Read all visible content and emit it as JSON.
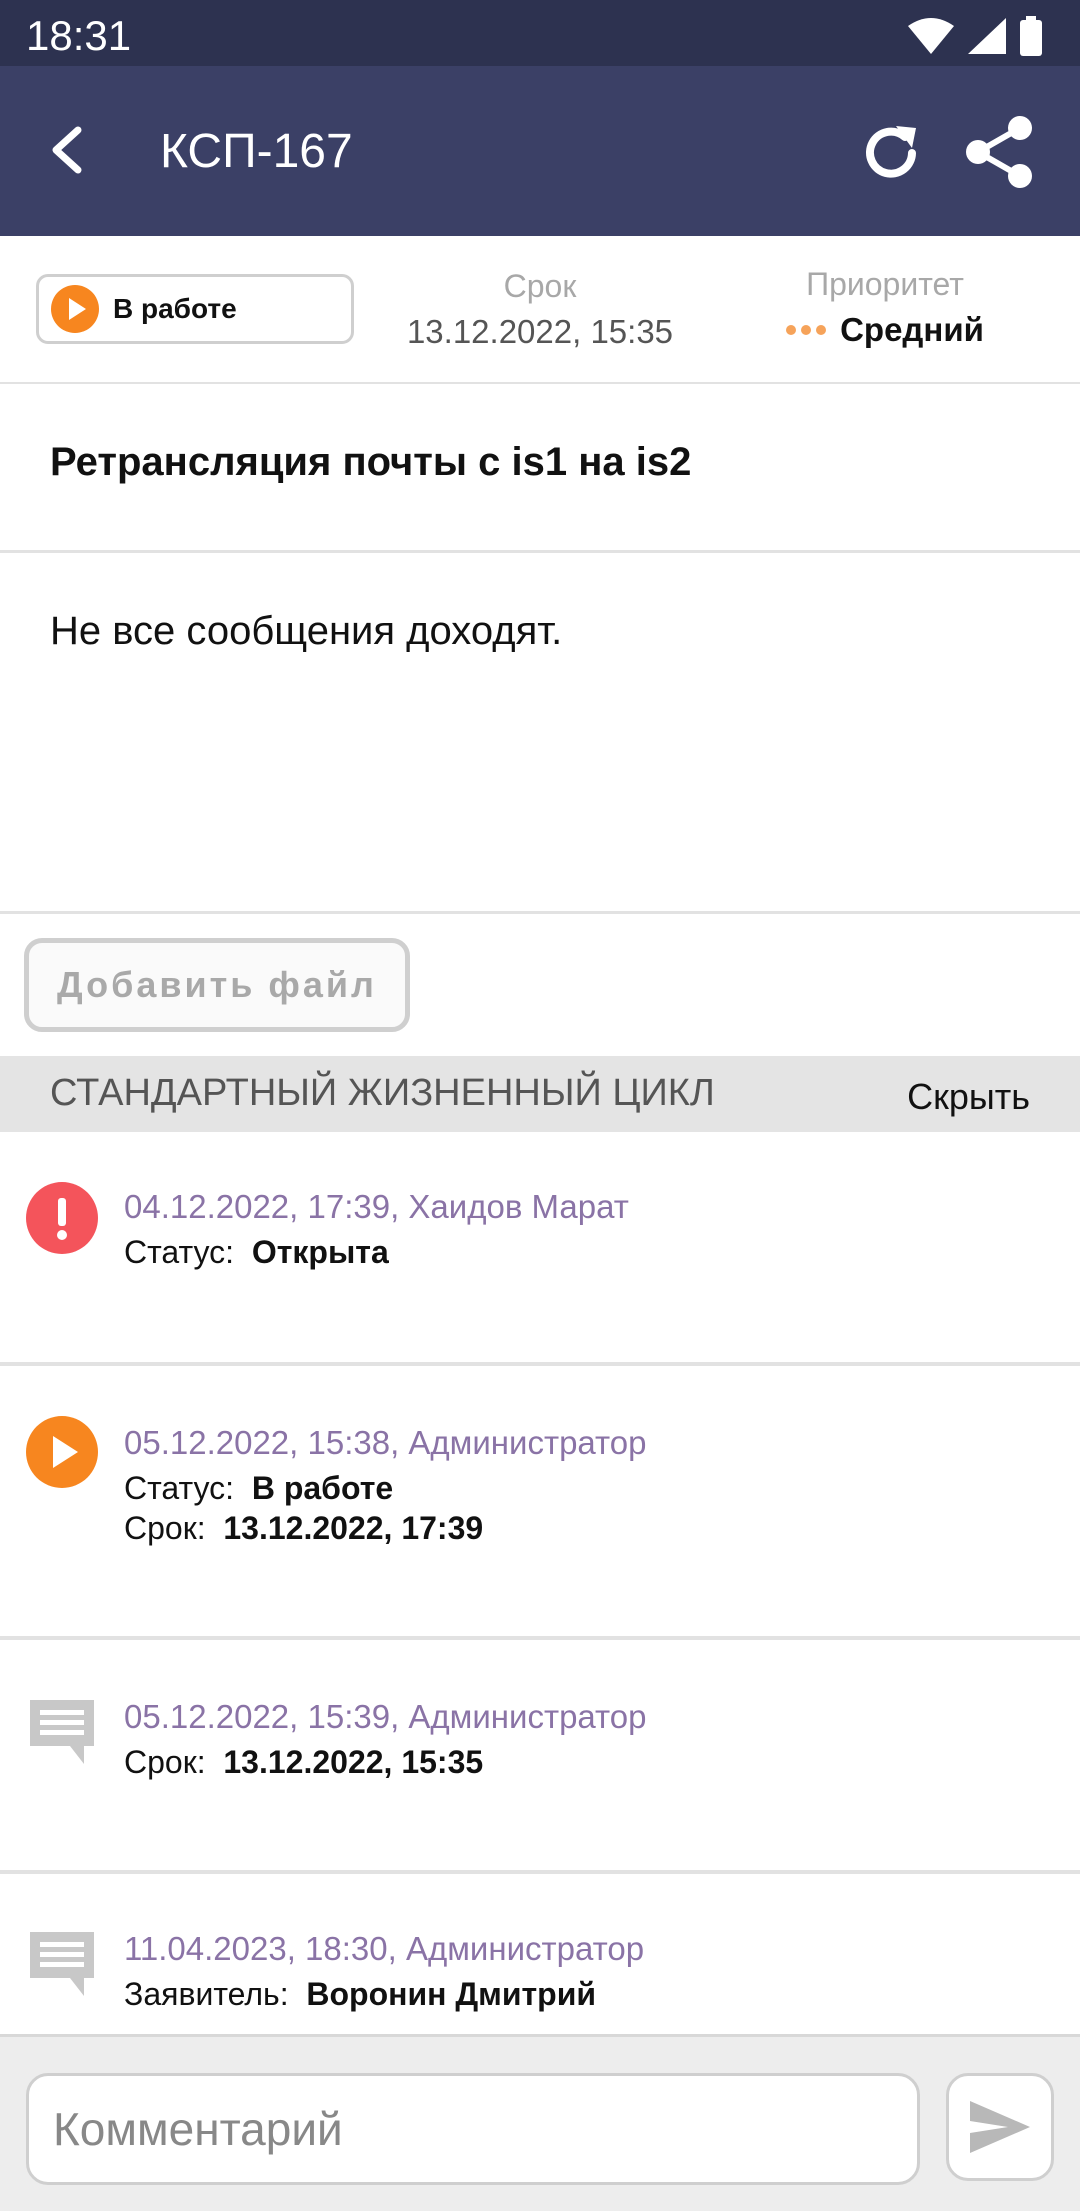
{
  "status_bar": {
    "time": "18:31"
  },
  "app_bar": {
    "title": "КСП-167",
    "icons": [
      "back-arrow-icon",
      "refresh-icon",
      "share-icon"
    ]
  },
  "info": {
    "status_label": "В работе",
    "deadline_caption": "Срок",
    "deadline_value": "13.12.2022, 15:35",
    "priority_caption": "Приоритет",
    "priority_value": "Средний"
  },
  "ticket": {
    "subject": "Ретрансляция почты с is1 на is2",
    "description": "Не все сообщения доходят."
  },
  "attach_button": "Добавить файл",
  "lifecycle": {
    "title": "СТАНДАРТНЫЙ ЖИЗНЕННЫЙ ЦИКЛ",
    "hide_label": "Скрыть",
    "entries": [
      {
        "icon": "alert-icon",
        "meta": "04.12.2022, 17:39, Хаидов Марат",
        "lines": [
          {
            "label": "Статус:",
            "value": "Открыта"
          }
        ]
      },
      {
        "icon": "play-icon",
        "meta": "05.12.2022, 15:38, Администратор",
        "lines": [
          {
            "label": "Статус:",
            "value": "В работе"
          },
          {
            "label": "Срок:",
            "value": "13.12.2022, 17:39"
          }
        ]
      },
      {
        "icon": "comment-icon",
        "meta": "05.12.2022, 15:39, Администратор",
        "lines": [
          {
            "label": "Срок:",
            "value": "13.12.2022, 15:35"
          }
        ]
      },
      {
        "icon": "comment-icon",
        "meta": "11.04.2023, 18:30, Администратор",
        "lines": [
          {
            "label": "Заявитель:",
            "value": "Воронин Дмитрий"
          }
        ]
      }
    ]
  },
  "composer": {
    "placeholder": "Комментарий"
  },
  "colors": {
    "header": "#3b4066",
    "status_bar": "#2d3250",
    "orange": "#f7861f",
    "alert_red": "#f4545b",
    "meta_purple": "#8a73a6"
  }
}
